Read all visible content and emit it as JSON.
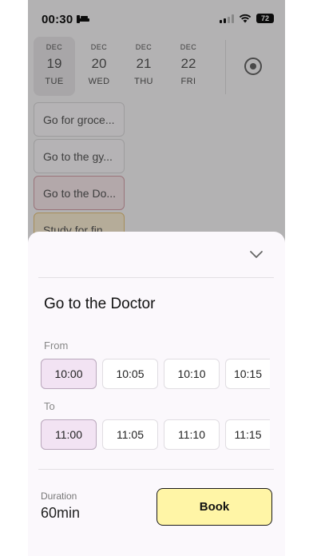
{
  "status": {
    "time": "00:30",
    "battery": "72"
  },
  "days": [
    {
      "month": "DEC",
      "date": "19",
      "weekday": "TUE",
      "selected": true
    },
    {
      "month": "DEC",
      "date": "20",
      "weekday": "WED"
    },
    {
      "month": "DEC",
      "date": "21",
      "weekday": "THU"
    },
    {
      "month": "DEC",
      "date": "22",
      "weekday": "FRI"
    }
  ],
  "tasks": [
    "Go for groce...",
    "Go to the gy...",
    "Go to the Do...",
    "Study for fin..."
  ],
  "sheet": {
    "title": "Go to the Doctor",
    "from_label": "From",
    "from_times": [
      "10:00",
      "10:05",
      "10:10",
      "10:15"
    ],
    "to_label": "To",
    "to_times": [
      "11:00",
      "11:05",
      "11:10",
      "11:15"
    ],
    "duration_label": "Duration",
    "duration_value": "60min",
    "book_label": "Book"
  },
  "colors": {
    "book_bg": "#fff5a6",
    "selected_slot": "#f2e3f3",
    "active_task_border": "#d3a0a8"
  }
}
